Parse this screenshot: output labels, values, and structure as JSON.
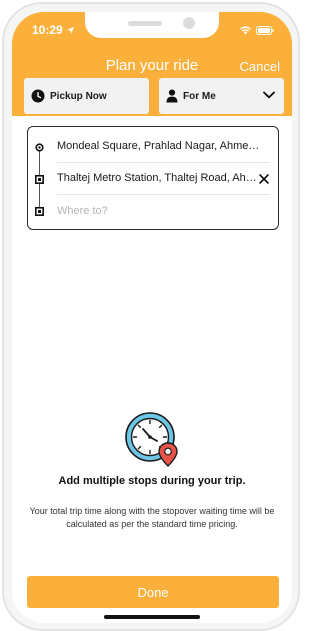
{
  "status_bar": {
    "time": "10:29",
    "icons": [
      "location-arrow-icon",
      "wifi-icon",
      "battery-icon"
    ]
  },
  "header": {
    "title": "Plan your ride",
    "cancel_label": "Cancel"
  },
  "options": {
    "pickup_label": "Pickup Now",
    "pickup_icon": "clock-icon",
    "rider_label": "For Me",
    "rider_icon": "person-icon"
  },
  "route": {
    "stops": [
      {
        "text": "Mondeal Square, Prahlad Nagar, Ahmedabad"
      },
      {
        "text": "Thaltej Metro Station, Thaltej Road, Ahmedabad"
      }
    ],
    "destination_placeholder": "Where to?",
    "destination_value": ""
  },
  "info": {
    "heading": "Add multiple stops during your trip.",
    "description": "Your total trip time along with the stopover waiting time will be calculated as per the standard time pricing.",
    "illustration_icon": "clock-with-location-pin-icon"
  },
  "footer": {
    "done_label": "Done"
  },
  "colors": {
    "accent": "#fbb03b",
    "text": "#1a1a1a",
    "muted": "#b5b5b5",
    "illustration_blue": "#6ec6e6",
    "illustration_pin": "#e8534a"
  }
}
